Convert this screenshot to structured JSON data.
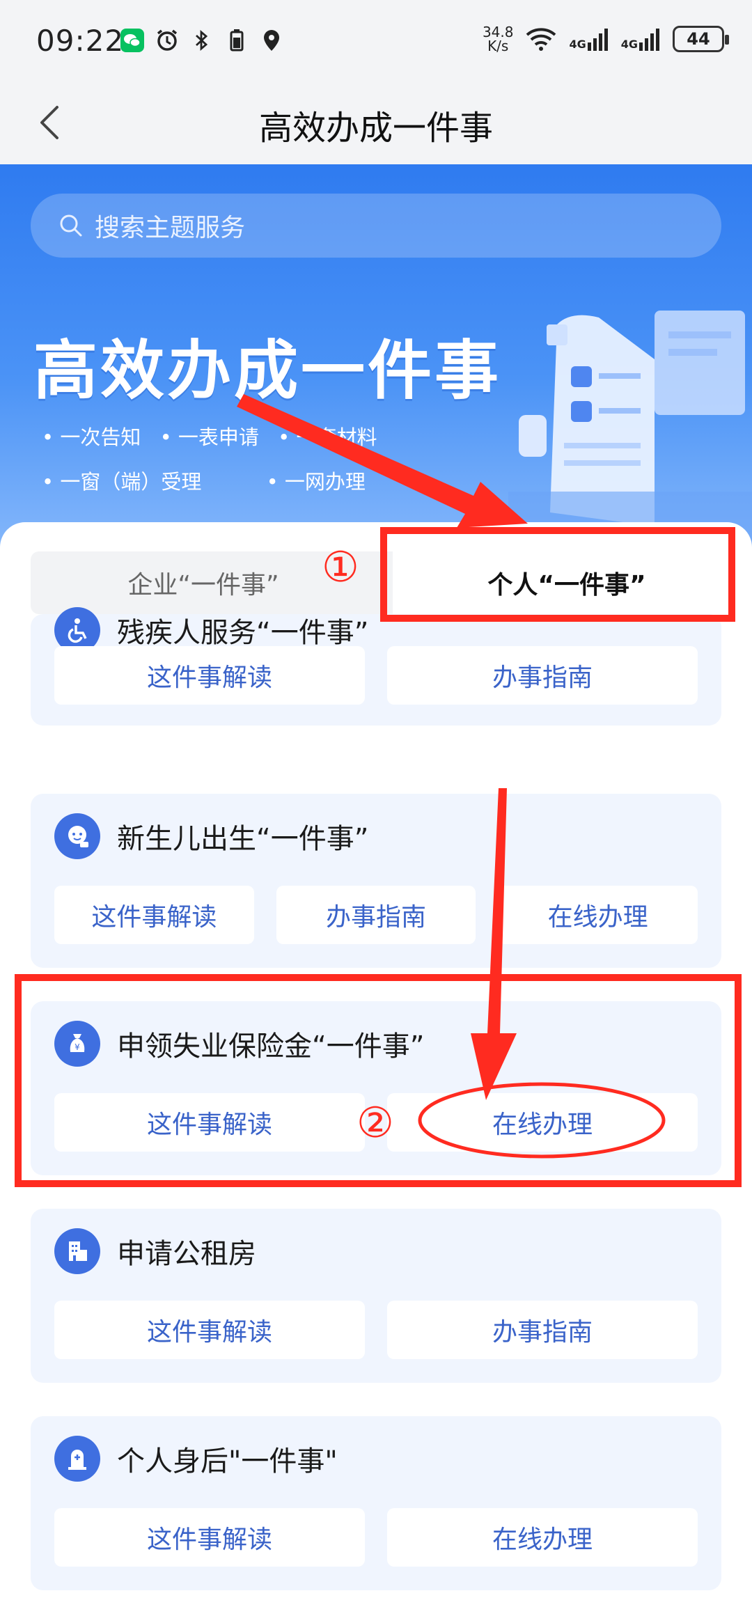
{
  "status": {
    "time": "09:22",
    "net_speed_value": "34.8",
    "net_speed_unit": "K/s",
    "signal1": "4G",
    "signal2": "4G",
    "battery": "44"
  },
  "nav": {
    "title": "高效办成一件事"
  },
  "search": {
    "placeholder": "搜索主题服务"
  },
  "hero": {
    "title": "高效办成一件事",
    "bullets_row1": [
      "一次告知",
      "一表申请",
      "一套材料"
    ],
    "bullets_row2": [
      "一窗（端）受理",
      "一网办理"
    ]
  },
  "tabs": [
    {
      "label": "企业“一件事”"
    },
    {
      "label": "个人“一件事”"
    }
  ],
  "cards": [
    {
      "title": "残疾人服务“一件事”",
      "icon": "wheelchair-icon",
      "buttons": [
        "这件事解读",
        "办事指南"
      ]
    },
    {
      "title": "新生儿出生“一件事”",
      "icon": "baby-icon",
      "buttons": [
        "这件事解读",
        "办事指南",
        "在线办理"
      ]
    },
    {
      "title": "申领失业保险金“一件事”",
      "icon": "money-bag-icon",
      "buttons": [
        "这件事解读",
        "在线办理"
      ]
    },
    {
      "title": "申请公租房",
      "icon": "building-icon",
      "buttons": [
        "这件事解读",
        "办事指南"
      ]
    },
    {
      "title": "个人身后\"一件事\"",
      "icon": "memorial-icon",
      "buttons": [
        "这件事解读",
        "在线办理"
      ]
    }
  ],
  "annotations": {
    "step1": "①",
    "step2": "②"
  },
  "colors": {
    "accent": "#3f6fe0",
    "button_text": "#3a63c9",
    "annotation": "#ff2b20"
  }
}
